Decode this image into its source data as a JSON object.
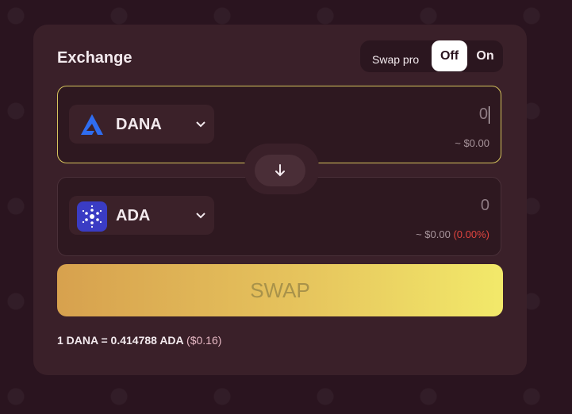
{
  "card": {
    "title": "Exchange"
  },
  "toggle": {
    "label": "Swap pro",
    "off": "Off",
    "on": "On",
    "selected": "Off"
  },
  "from": {
    "token": "DANA",
    "icon": "dana-logo-icon",
    "amount": "0",
    "usd": "~ $0.00"
  },
  "to": {
    "token": "ADA",
    "icon": "cardano-logo-icon",
    "amount": "0",
    "usd": "~ $0.00",
    "change": "(0.00%)"
  },
  "swap": {
    "label": "SWAP"
  },
  "rate": {
    "text": "1 DANA = 0.414788 ADA",
    "usd": "($0.16)"
  },
  "colors": {
    "background": "#2a141f",
    "card": "#3a2029",
    "accent_border": "#d6c45d",
    "swap_gradient_start": "#d7a14e",
    "swap_gradient_end": "#f2e96a",
    "negative": "#e0443f"
  }
}
